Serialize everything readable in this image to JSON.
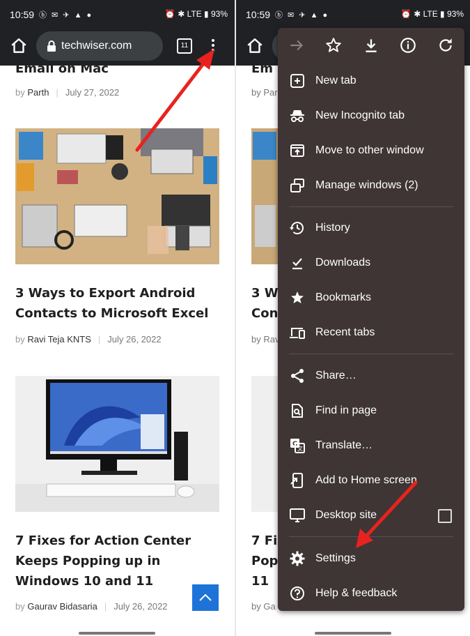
{
  "status": {
    "time": "10:59",
    "left_icons": "ⓑ ✉ ✈ ▲ ●",
    "right_icons": "⏰ ✱ LTE ▮ 93%"
  },
  "browser": {
    "url": "techwiser.com",
    "tab_count": "11"
  },
  "articles": [
    {
      "title": "Email on Mac",
      "by": "by",
      "author": "Parth",
      "date": "July 27, 2022"
    },
    {
      "title": "3 Ways to Export Android Contacts to Microsoft Excel",
      "by": "by",
      "author": "Ravi Teja KNTS",
      "date": "July 26, 2022"
    },
    {
      "title": "7 Fixes for Action Center Keeps Popping up in Windows 10 and 11",
      "by": "by",
      "author": "Gaurav Bidasaria",
      "date": "July 26, 2022"
    }
  ],
  "right_articles": [
    {
      "title": "Em"
    },
    {
      "meta": "by Par"
    },
    {
      "title": "3 W"
    },
    {
      "title2": "Con"
    },
    {
      "meta": "by Rav"
    },
    {
      "title": "7 Fix"
    },
    {
      "title2": "Popp"
    },
    {
      "title3": "11"
    },
    {
      "meta": "by Ga"
    }
  ],
  "menu": {
    "top_icons": [
      "forward-icon",
      "star-icon",
      "download-icon",
      "info-icon",
      "refresh-icon"
    ],
    "items": [
      {
        "label": "New tab",
        "icon": "plus-box-icon"
      },
      {
        "label": "New Incognito tab",
        "icon": "incognito-icon"
      },
      {
        "label": "Move to other window",
        "icon": "move-window-icon"
      },
      {
        "label": "Manage windows (2)",
        "icon": "windows-icon"
      },
      {
        "label": "History",
        "icon": "history-icon"
      },
      {
        "label": "Downloads",
        "icon": "downloads-icon"
      },
      {
        "label": "Bookmarks",
        "icon": "bookmark-star-icon"
      },
      {
        "label": "Recent tabs",
        "icon": "devices-icon"
      },
      {
        "label": "Share…",
        "icon": "share-icon"
      },
      {
        "label": "Find in page",
        "icon": "find-icon"
      },
      {
        "label": "Translate…",
        "icon": "translate-icon"
      },
      {
        "label": "Add to Home screen",
        "icon": "add-home-icon"
      },
      {
        "label": "Desktop site",
        "icon": "desktop-icon"
      },
      {
        "label": "Settings",
        "icon": "gear-icon"
      },
      {
        "label": "Help & feedback",
        "icon": "help-icon"
      }
    ]
  },
  "colors": {
    "toolbar": "#202124",
    "menu_bg": "#3e3534",
    "accent_blue": "#1e73d8",
    "annotation_red": "#e8231f"
  }
}
